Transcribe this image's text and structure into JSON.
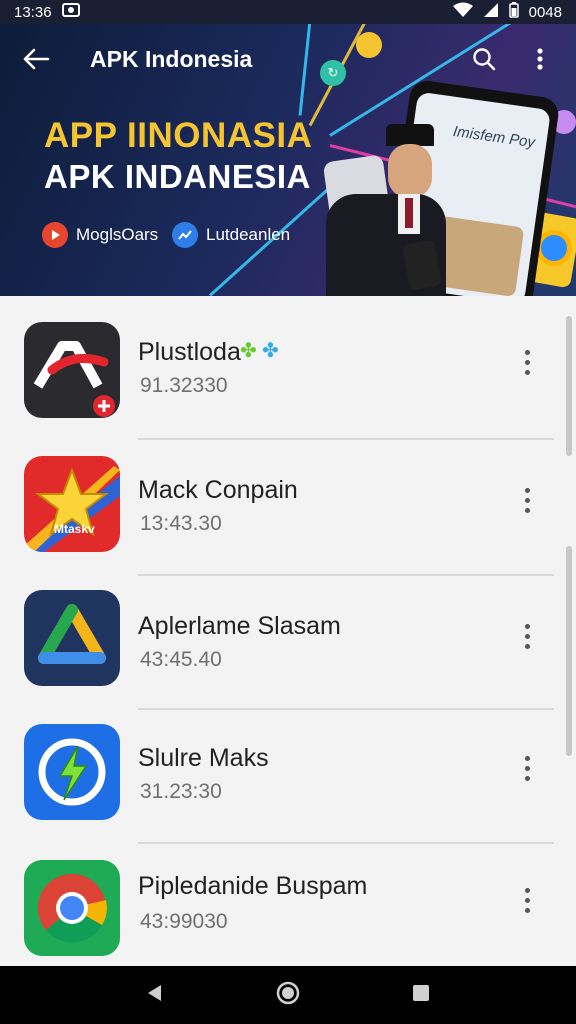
{
  "status_bar": {
    "time": "13:36",
    "battery": "0048"
  },
  "app_bar": {
    "title": "APK Indonesia"
  },
  "banner": {
    "headline_1": "APP IINONASIA",
    "headline_2": "APK INDANESIA",
    "chip_1": "MoglsOars",
    "chip_2": "Lutdeanlen",
    "phone_text": "Imisfem Poy"
  },
  "apps": [
    {
      "name": "Plustloda",
      "version": "91.32330",
      "icon": "red-a-icon"
    },
    {
      "name": "Mack Conpain",
      "version": "13:43.30",
      "icon": "star-icon",
      "icon_label": "Mtaskv"
    },
    {
      "name": "Aplerlame Slasam",
      "version": "43:45.40",
      "icon": "triangle-icon"
    },
    {
      "name": "Slulre Maks",
      "version": "31.23:30",
      "icon": "lightning-icon"
    },
    {
      "name": "Pipledanide Buspam",
      "version": "43:99030",
      "icon": "chrome-icon"
    }
  ],
  "colors": {
    "headline_accent": "#f5c531",
    "banner_dark": "#0e1c3a",
    "list_bg": "#f3f3f3"
  }
}
